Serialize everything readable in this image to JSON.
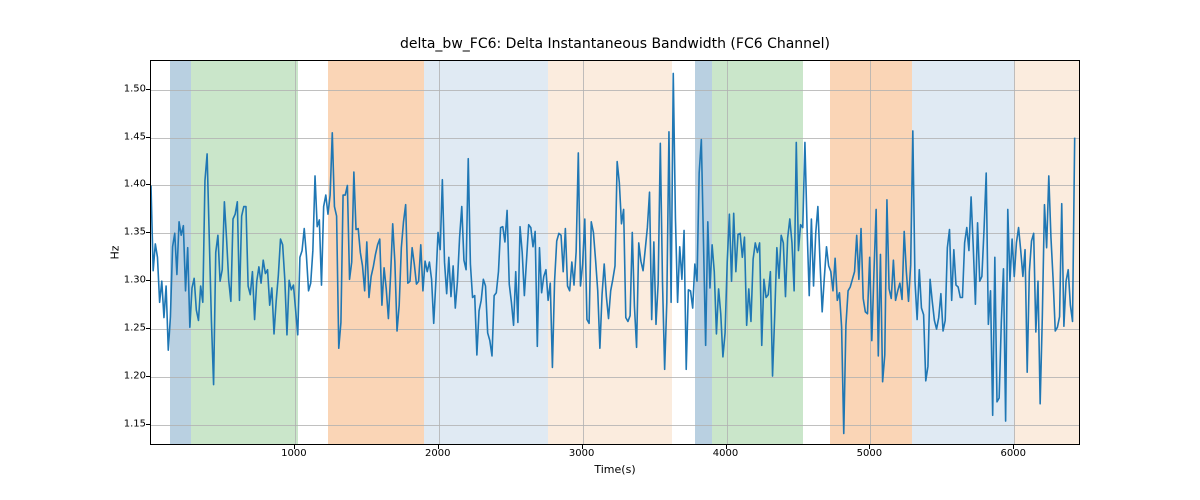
{
  "chart_data": {
    "type": "line",
    "title": "delta_bw_FC6: Delta Instantaneous Bandwidth (FC6 Channel)",
    "xlabel": "Time(s)",
    "ylabel": "Hz",
    "xlim": [
      0,
      6450
    ],
    "ylim": [
      1.13,
      1.53
    ],
    "xticks": [
      1000,
      2000,
      3000,
      4000,
      5000,
      6000
    ],
    "yticks": [
      1.15,
      1.2,
      1.25,
      1.3,
      1.35,
      1.4,
      1.45,
      1.5
    ],
    "ytick_labels": [
      "1.15",
      "1.20",
      "1.25",
      "1.30",
      "1.35",
      "1.40",
      "1.45",
      "1.50"
    ],
    "line_color": "#1f77b4",
    "bands": [
      {
        "x0": 130,
        "x1": 280,
        "color": "#7fa9c9",
        "alpha": 0.55
      },
      {
        "x0": 280,
        "x1": 1020,
        "color": "#9fd19f",
        "alpha": 0.55
      },
      {
        "x0": 1230,
        "x1": 1900,
        "color": "#f5b27a",
        "alpha": 0.55
      },
      {
        "x0": 1900,
        "x1": 2760,
        "color": "#c7d8ea",
        "alpha": 0.55
      },
      {
        "x0": 2760,
        "x1": 3620,
        "color": "#f7dcc2",
        "alpha": 0.55
      },
      {
        "x0": 3780,
        "x1": 3900,
        "color": "#7fa9c9",
        "alpha": 0.55
      },
      {
        "x0": 3900,
        "x1": 4530,
        "color": "#9fd19f",
        "alpha": 0.55
      },
      {
        "x0": 4720,
        "x1": 5290,
        "color": "#f5b27a",
        "alpha": 0.55
      },
      {
        "x0": 5290,
        "x1": 6000,
        "color": "#c7d8ea",
        "alpha": 0.55
      },
      {
        "x0": 6000,
        "x1": 6450,
        "color": "#f7dcc2",
        "alpha": 0.55
      }
    ],
    "x": [
      0,
      15,
      30,
      45,
      60,
      75,
      90,
      105,
      120,
      135,
      150,
      165,
      180,
      195,
      210,
      225,
      240,
      255,
      270,
      285,
      300,
      315,
      330,
      345,
      360,
      375,
      390,
      405,
      420,
      435,
      450,
      465,
      480,
      495,
      510,
      525,
      540,
      555,
      570,
      585,
      600,
      615,
      630,
      645,
      660,
      675,
      690,
      705,
      720,
      735,
      750,
      765,
      780,
      795,
      810,
      825,
      840,
      855,
      870,
      885,
      900,
      915,
      930,
      945,
      960,
      975,
      990,
      1005,
      1020,
      1035,
      1050,
      1065,
      1080,
      1095,
      1110,
      1125,
      1140,
      1155,
      1170,
      1185,
      1200,
      1215,
      1230,
      1245,
      1260,
      1275,
      1290,
      1305,
      1320,
      1335,
      1350,
      1365,
      1380,
      1395,
      1410,
      1425,
      1440,
      1455,
      1470,
      1485,
      1500,
      1515,
      1530,
      1545,
      1560,
      1575,
      1590,
      1605,
      1620,
      1635,
      1650,
      1665,
      1680,
      1695,
      1710,
      1725,
      1740,
      1755,
      1770,
      1785,
      1800,
      1815,
      1830,
      1845,
      1860,
      1875,
      1890,
      1905,
      1920,
      1935,
      1950,
      1965,
      1980,
      1995,
      2010,
      2025,
      2040,
      2055,
      2070,
      2085,
      2100,
      2115,
      2130,
      2145,
      2160,
      2175,
      2190,
      2205,
      2220,
      2235,
      2250,
      2265,
      2280,
      2295,
      2310,
      2325,
      2340,
      2355,
      2370,
      2385,
      2400,
      2415,
      2430,
      2445,
      2460,
      2475,
      2490,
      2505,
      2520,
      2535,
      2550,
      2565,
      2580,
      2595,
      2610,
      2625,
      2640,
      2655,
      2670,
      2685,
      2700,
      2715,
      2730,
      2745,
      2760,
      2775,
      2790,
      2805,
      2820,
      2835,
      2850,
      2865,
      2880,
      2895,
      2910,
      2925,
      2940,
      2955,
      2970,
      2985,
      3000,
      3015,
      3030,
      3045,
      3060,
      3075,
      3090,
      3105,
      3120,
      3135,
      3150,
      3165,
      3180,
      3195,
      3210,
      3225,
      3240,
      3255,
      3270,
      3285,
      3300,
      3315,
      3330,
      3345,
      3360,
      3375,
      3390,
      3405,
      3420,
      3435,
      3450,
      3465,
      3480,
      3495,
      3510,
      3525,
      3540,
      3555,
      3570,
      3585,
      3600,
      3615,
      3630,
      3645,
      3660,
      3675,
      3690,
      3705,
      3720,
      3735,
      3750,
      3765,
      3780,
      3795,
      3810,
      3825,
      3840,
      3855,
      3870,
      3885,
      3900,
      3915,
      3930,
      3945,
      3960,
      3975,
      3990,
      4005,
      4020,
      4035,
      4050,
      4065,
      4080,
      4095,
      4110,
      4125,
      4140,
      4155,
      4170,
      4185,
      4200,
      4215,
      4230,
      4245,
      4260,
      4275,
      4290,
      4305,
      4320,
      4335,
      4350,
      4365,
      4380,
      4395,
      4410,
      4425,
      4440,
      4455,
      4470,
      4485,
      4500,
      4515,
      4530,
      4545,
      4560,
      4575,
      4590,
      4605,
      4620,
      4635,
      4650,
      4665,
      4680,
      4695,
      4710,
      4725,
      4740,
      4755,
      4770,
      4785,
      4800,
      4815,
      4830,
      4845,
      4860,
      4875,
      4890,
      4905,
      4920,
      4935,
      4950,
      4965,
      4980,
      4995,
      5010,
      5025,
      5040,
      5055,
      5070,
      5085,
      5100,
      5115,
      5130,
      5145,
      5160,
      5175,
      5190,
      5205,
      5220,
      5235,
      5250,
      5265,
      5280,
      5295,
      5310,
      5325,
      5340,
      5355,
      5370,
      5385,
      5400,
      5415,
      5430,
      5445,
      5460,
      5475,
      5490,
      5505,
      5520,
      5535,
      5550,
      5565,
      5580,
      5595,
      5610,
      5625,
      5640,
      5655,
      5670,
      5685,
      5700,
      5715,
      5730,
      5745,
      5760,
      5775,
      5790,
      5805,
      5820,
      5835,
      5850,
      5865,
      5880,
      5895,
      5910,
      5925,
      5940,
      5955,
      5970,
      5985,
      6000,
      6015,
      6030,
      6045,
      6060,
      6075,
      6090,
      6105,
      6120,
      6135,
      6150,
      6165,
      6180,
      6195,
      6210,
      6225,
      6240,
      6255,
      6270,
      6285,
      6300,
      6315,
      6330,
      6345,
      6360,
      6375,
      6390,
      6405,
      6420,
      6435,
      6450
    ],
    "values": [
      1.4,
      1.311,
      1.339,
      1.325,
      1.278,
      1.3,
      1.262,
      1.295,
      1.228,
      1.263,
      1.336,
      1.35,
      1.307,
      1.362,
      1.348,
      1.358,
      1.29,
      1.335,
      1.252,
      1.293,
      1.303,
      1.27,
      1.259,
      1.295,
      1.278,
      1.405,
      1.433,
      1.345,
      1.258,
      1.192,
      1.33,
      1.348,
      1.3,
      1.312,
      1.383,
      1.345,
      1.301,
      1.279,
      1.365,
      1.37,
      1.383,
      1.28,
      1.368,
      1.378,
      1.378,
      1.295,
      1.286,
      1.31,
      1.26,
      1.3,
      1.315,
      1.298,
      1.322,
      1.308,
      1.312,
      1.275,
      1.293,
      1.245,
      1.279,
      1.306,
      1.344,
      1.338,
      1.302,
      1.244,
      1.301,
      1.291,
      1.296,
      1.27,
      1.244,
      1.325,
      1.332,
      1.355,
      1.327,
      1.29,
      1.298,
      1.332,
      1.41,
      1.357,
      1.364,
      1.296,
      1.378,
      1.39,
      1.37,
      1.39,
      1.455,
      1.378,
      1.368,
      1.23,
      1.257,
      1.39,
      1.39,
      1.4,
      1.302,
      1.32,
      1.414,
      1.354,
      1.355,
      1.33,
      1.316,
      1.29,
      1.341,
      1.283,
      1.305,
      1.315,
      1.328,
      1.338,
      1.344,
      1.275,
      1.314,
      1.292,
      1.261,
      1.305,
      1.36,
      1.32,
      1.248,
      1.275,
      1.335,
      1.362,
      1.38,
      1.298,
      1.3,
      1.335,
      1.318,
      1.297,
      1.3,
      1.338,
      1.29,
      1.321,
      1.31,
      1.32,
      1.302,
      1.256,
      1.3,
      1.351,
      1.333,
      1.406,
      1.32,
      1.287,
      1.325,
      1.284,
      1.316,
      1.272,
      1.3,
      1.346,
      1.378,
      1.322,
      1.312,
      1.428,
      1.318,
      1.283,
      1.285,
      1.223,
      1.269,
      1.28,
      1.302,
      1.295,
      1.246,
      1.238,
      1.222,
      1.285,
      1.288,
      1.31,
      1.356,
      1.357,
      1.341,
      1.374,
      1.297,
      1.278,
      1.254,
      1.31,
      1.257,
      1.357,
      1.33,
      1.285,
      1.322,
      1.359,
      1.356,
      1.336,
      1.352,
      1.232,
      1.335,
      1.288,
      1.305,
      1.312,
      1.28,
      1.298,
      1.21,
      1.3,
      1.342,
      1.35,
      1.348,
      1.31,
      1.355,
      1.295,
      1.29,
      1.32,
      1.296,
      1.331,
      1.434,
      1.295,
      1.318,
      1.365,
      1.26,
      1.256,
      1.362,
      1.351,
      1.322,
      1.29,
      1.23,
      1.286,
      1.318,
      1.284,
      1.261,
      1.29,
      1.302,
      1.316,
      1.425,
      1.403,
      1.36,
      1.375,
      1.262,
      1.258,
      1.264,
      1.351,
      1.274,
      1.231,
      1.34,
      1.321,
      1.311,
      1.333,
      1.356,
      1.393,
      1.26,
      1.341,
      1.255,
      1.298,
      1.444,
      1.3,
      1.208,
      1.278,
      1.456,
      1.278,
      1.517,
      1.366,
      1.278,
      1.336,
      1.302,
      1.353,
      1.208,
      1.291,
      1.29,
      1.272,
      1.318,
      1.3,
      1.413,
      1.448,
      1.341,
      1.233,
      1.362,
      1.293,
      1.338,
      1.31,
      1.245,
      1.292,
      1.266,
      1.221,
      1.246,
      1.32,
      1.37,
      1.3,
      1.371,
      1.31,
      1.349,
      1.35,
      1.325,
      1.346,
      1.254,
      1.292,
      1.258,
      1.323,
      1.34,
      1.33,
      1.34,
      1.233,
      1.302,
      1.283,
      1.286,
      1.31,
      1.201,
      1.264,
      1.335,
      1.303,
      1.348,
      1.34,
      1.284,
      1.345,
      1.365,
      1.34,
      1.29,
      1.445,
      1.332,
      1.359,
      1.356,
      1.445,
      1.356,
      1.285,
      1.365,
      1.295,
      1.35,
      1.378,
      1.32,
      1.268,
      1.304,
      1.336,
      1.316,
      1.31,
      1.29,
      1.324,
      1.28,
      1.288,
      1.252,
      1.141,
      1.254,
      1.29,
      1.294,
      1.302,
      1.31,
      1.348,
      1.302,
      1.355,
      1.282,
      1.268,
      1.266,
      1.325,
      1.238,
      1.31,
      1.375,
      1.222,
      1.328,
      1.195,
      1.223,
      1.385,
      1.292,
      1.282,
      1.322,
      1.28,
      1.29,
      1.298,
      1.281,
      1.352,
      1.31,
      1.279,
      1.317,
      1.457,
      1.3,
      1.26,
      1.312,
      1.272,
      1.265,
      1.196,
      1.211,
      1.302,
      1.279,
      1.259,
      1.25,
      1.262,
      1.287,
      1.248,
      1.259,
      1.335,
      1.354,
      1.28,
      1.333,
      1.296,
      1.294,
      1.283,
      1.283,
      1.34,
      1.356,
      1.332,
      1.388,
      1.336,
      1.276,
      1.361,
      1.3,
      1.305,
      1.354,
      1.413,
      1.255,
      1.29,
      1.16,
      1.325,
      1.174,
      1.178,
      1.257,
      1.313,
      1.154,
      1.375,
      1.3,
      1.344,
      1.305,
      1.34,
      1.356,
      1.332,
      1.305,
      1.333,
      1.205,
      1.31,
      1.342,
      1.35,
      1.247,
      1.3,
      1.172,
      1.262,
      1.38,
      1.335,
      1.41,
      1.346,
      1.302,
      1.248,
      1.252,
      1.263,
      1.381,
      1.253,
      1.3,
      1.312,
      1.275,
      1.258,
      1.45
    ]
  }
}
